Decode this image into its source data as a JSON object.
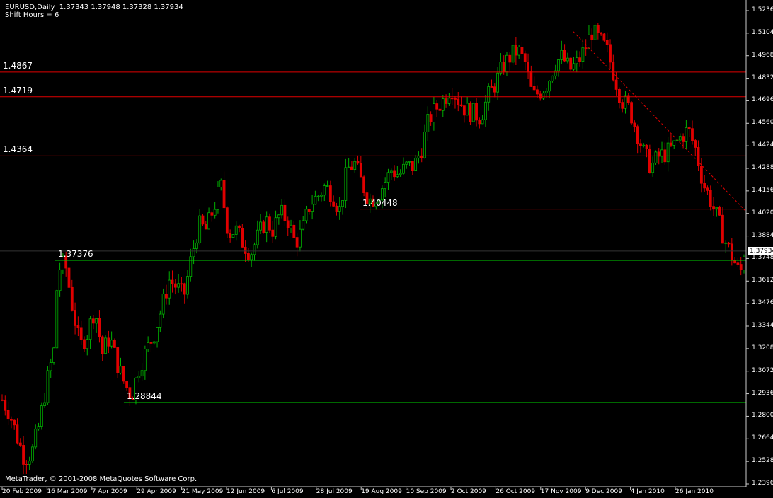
{
  "header": {
    "symbol": "EURUSD,Daily",
    "ohlc": "1.37343 1.37948 1.37328 1.37934",
    "shift": "Shift Hours = 6"
  },
  "copyright": "MetaTrader, © 2001-2008 MetaQuotes Software Corp.",
  "current_price": "1.37934",
  "colors": {
    "background": "#000000",
    "grid": "#808080",
    "bull_candle": "#00b000",
    "bear_candle": "#e00000",
    "resistance": "#e00000",
    "support": "#00d000"
  },
  "levels": [
    {
      "name": "level-14867",
      "label": "1.4867",
      "price": 1.4867,
      "kind": "resistance",
      "from": 0
    },
    {
      "name": "level-14719",
      "label": "1.4719",
      "price": 1.4719,
      "kind": "resistance",
      "from": 0
    },
    {
      "name": "level-14364",
      "label": "1.4364",
      "price": 1.4364,
      "kind": "resistance",
      "from": 0
    },
    {
      "name": "level-140448",
      "label": "1.40448",
      "price": 1.40448,
      "kind": "resistance",
      "from": 0.482
    },
    {
      "name": "level-137376",
      "label": "1.37376",
      "price": 1.37376,
      "kind": "support",
      "from": 0.074
    },
    {
      "name": "level-128844",
      "label": "1.28844",
      "price": 1.28844,
      "kind": "support",
      "from": 0.166
    }
  ],
  "trendline": {
    "from_x": 0.77,
    "from_price": 1.511,
    "to_x": 1.0,
    "to_price": 1.403
  },
  "chart_data": {
    "type": "candlestick",
    "title": "EURUSD,Daily",
    "ylim": [
      1.2396,
      1.5236
    ],
    "y_ticks": [
      "1.52360",
      "1.51040",
      "1.49680",
      "1.48320",
      "1.46960",
      "1.45600",
      "1.44240",
      "1.42880",
      "1.41560",
      "1.40200",
      "1.38840",
      "1.37480",
      "1.36120",
      "1.34760",
      "1.33440",
      "1.32080",
      "1.30720",
      "1.29360",
      "1.28000",
      "1.26640",
      "1.25280",
      "1.23960"
    ],
    "x_ticks": [
      "20 Feb 2009",
      "16 Mar 2009",
      "7 Apr 2009",
      "29 Apr 2009",
      "21 May 2009",
      "12 Jun 2009",
      "6 Jul 2009",
      "28 Jul 2009",
      "19 Aug 2009",
      "10 Sep 2009",
      "2 Oct 2009",
      "26 Oct 2009",
      "17 Nov 2009",
      "9 Dec 2009",
      "4 Jan 2010",
      "26 Jan 2010"
    ],
    "close_path": [
      [
        0,
        1.29
      ],
      [
        0.01,
        1.282
      ],
      [
        0.02,
        1.268
      ],
      [
        0.03,
        1.255
      ],
      [
        0.04,
        1.258
      ],
      [
        0.05,
        1.275
      ],
      [
        0.06,
        1.3
      ],
      [
        0.07,
        1.32
      ],
      [
        0.075,
        1.368
      ],
      [
        0.085,
        1.372
      ],
      [
        0.095,
        1.345
      ],
      [
        0.105,
        1.322
      ],
      [
        0.115,
        1.33
      ],
      [
        0.125,
        1.345
      ],
      [
        0.135,
        1.318
      ],
      [
        0.145,
        1.328
      ],
      [
        0.155,
        1.312
      ],
      [
        0.165,
        1.3
      ],
      [
        0.175,
        1.292
      ],
      [
        0.185,
        1.31
      ],
      [
        0.195,
        1.32
      ],
      [
        0.205,
        1.33
      ],
      [
        0.215,
        1.345
      ],
      [
        0.225,
        1.362
      ],
      [
        0.235,
        1.358
      ],
      [
        0.245,
        1.352
      ],
      [
        0.255,
        1.375
      ],
      [
        0.265,
        1.395
      ],
      [
        0.275,
        1.392
      ],
      [
        0.285,
        1.405
      ],
      [
        0.295,
        1.418
      ],
      [
        0.305,
        1.39
      ],
      [
        0.315,
        1.392
      ],
      [
        0.325,
        1.384
      ],
      [
        0.335,
        1.378
      ],
      [
        0.345,
        1.388
      ],
      [
        0.355,
        1.398
      ],
      [
        0.365,
        1.392
      ],
      [
        0.375,
        1.402
      ],
      [
        0.385,
        1.398
      ],
      [
        0.395,
        1.384
      ],
      [
        0.405,
        1.392
      ],
      [
        0.415,
        1.408
      ],
      [
        0.425,
        1.412
      ],
      [
        0.435,
        1.418
      ],
      [
        0.445,
        1.414
      ],
      [
        0.455,
        1.404
      ],
      [
        0.465,
        1.428
      ],
      [
        0.475,
        1.432
      ],
      [
        0.485,
        1.42
      ],
      [
        0.495,
        1.41
      ],
      [
        0.505,
        1.412
      ],
      [
        0.515,
        1.42
      ],
      [
        0.525,
        1.428
      ],
      [
        0.535,
        1.425
      ],
      [
        0.545,
        1.43
      ],
      [
        0.555,
        1.43
      ],
      [
        0.565,
        1.44
      ],
      [
        0.575,
        1.458
      ],
      [
        0.585,
        1.465
      ],
      [
        0.595,
        1.47
      ],
      [
        0.605,
        1.478
      ],
      [
        0.615,
        1.47
      ],
      [
        0.625,
        1.464
      ],
      [
        0.635,
        1.462
      ],
      [
        0.645,
        1.46
      ],
      [
        0.655,
        1.472
      ],
      [
        0.665,
        1.48
      ],
      [
        0.675,
        1.49
      ],
      [
        0.685,
        1.496
      ],
      [
        0.695,
        1.5
      ],
      [
        0.705,
        1.492
      ],
      [
        0.715,
        1.472
      ],
      [
        0.725,
        1.475
      ],
      [
        0.735,
        1.48
      ],
      [
        0.745,
        1.492
      ],
      [
        0.755,
        1.496
      ],
      [
        0.765,
        1.488
      ],
      [
        0.775,
        1.492
      ],
      [
        0.785,
        1.5
      ],
      [
        0.795,
        1.511
      ],
      [
        0.805,
        1.506
      ],
      [
        0.815,
        1.5
      ],
      [
        0.825,
        1.485
      ],
      [
        0.835,
        1.47
      ],
      [
        0.845,
        1.465
      ],
      [
        0.855,
        1.452
      ],
      [
        0.865,
        1.438
      ],
      [
        0.875,
        1.43
      ],
      [
        0.885,
        1.436
      ],
      [
        0.895,
        1.438
      ],
      [
        0.905,
        1.442
      ],
      [
        0.915,
        1.448
      ],
      [
        0.925,
        1.452
      ],
      [
        0.935,
        1.44
      ],
      [
        0.945,
        1.42
      ],
      [
        0.955,
        1.41
      ],
      [
        0.965,
        1.398
      ],
      [
        0.975,
        1.385
      ],
      [
        0.985,
        1.375
      ],
      [
        0.995,
        1.365
      ],
      [
        1.0,
        1.379
      ]
    ]
  }
}
